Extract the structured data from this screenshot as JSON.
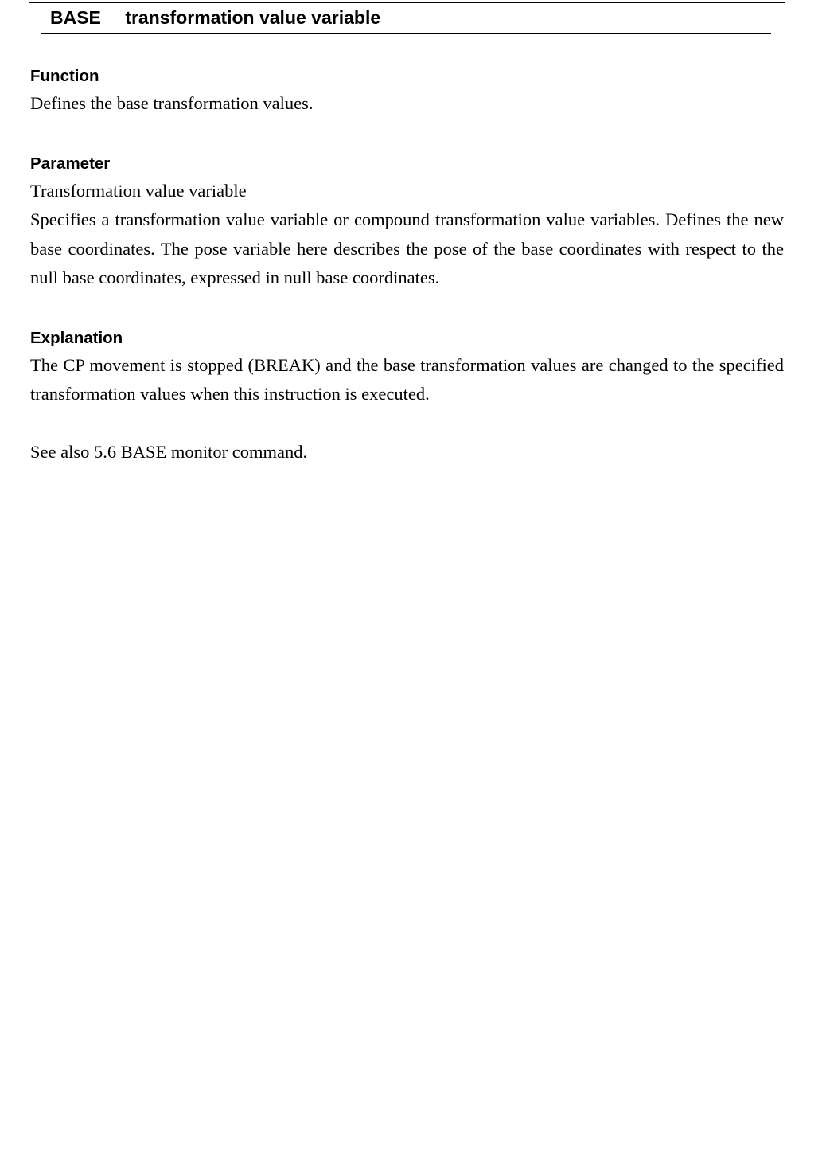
{
  "header": {
    "keyword": "BASE",
    "parameter": "transformation value variable"
  },
  "sections": {
    "function": {
      "heading": "Function",
      "text": "Defines the base transformation values."
    },
    "parameter": {
      "heading": "Parameter",
      "name": "Transformation value variable",
      "text": "Specifies a transformation value variable or compound transformation value variables.  Defines the new base coordinates. The pose variable here describes the pose of the base coordinates with respect to the null base coordinates, expressed in null base coordinates."
    },
    "explanation": {
      "heading": "Explanation",
      "text": "The CP movement is stopped (BREAK) and the base transformation values are changed to the specified transformation values when this instruction is executed.",
      "see_also": "See also 5.6 BASE monitor command."
    }
  }
}
